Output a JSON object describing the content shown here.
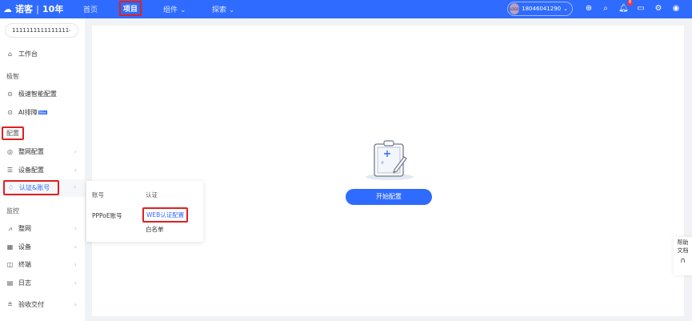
{
  "header": {
    "logo": "诺客",
    "logo_sub": "10年",
    "nav": [
      "首页",
      "项目",
      "组件",
      "探索"
    ],
    "active_nav": "项目",
    "user": {
      "avatar": "LOGO",
      "phone": "18046041290"
    },
    "notification_count": "8"
  },
  "sidebar": {
    "project_select": "1111111111111111",
    "workbench": "工作台",
    "group_ai": "极智",
    "ai_items": [
      "极速智能配置",
      "AI排障"
    ],
    "new_tag": "New",
    "group_config": "配置",
    "config_items": [
      "整网配置",
      "设备配置",
      "认证&账号"
    ],
    "group_monitor": "监控",
    "monitor_items": [
      "整网",
      "设备",
      "终端",
      "日志"
    ],
    "delivery": "验收交付"
  },
  "popup": {
    "col1_header": "账号",
    "col2_header": "认证",
    "col1_items": [
      "PPPoE账号"
    ],
    "col2_items": [
      "WEB认证配置",
      "白名单"
    ]
  },
  "main": {
    "start_button": "开始配置"
  },
  "help": {
    "line1": "帮助",
    "line2": "文档"
  }
}
